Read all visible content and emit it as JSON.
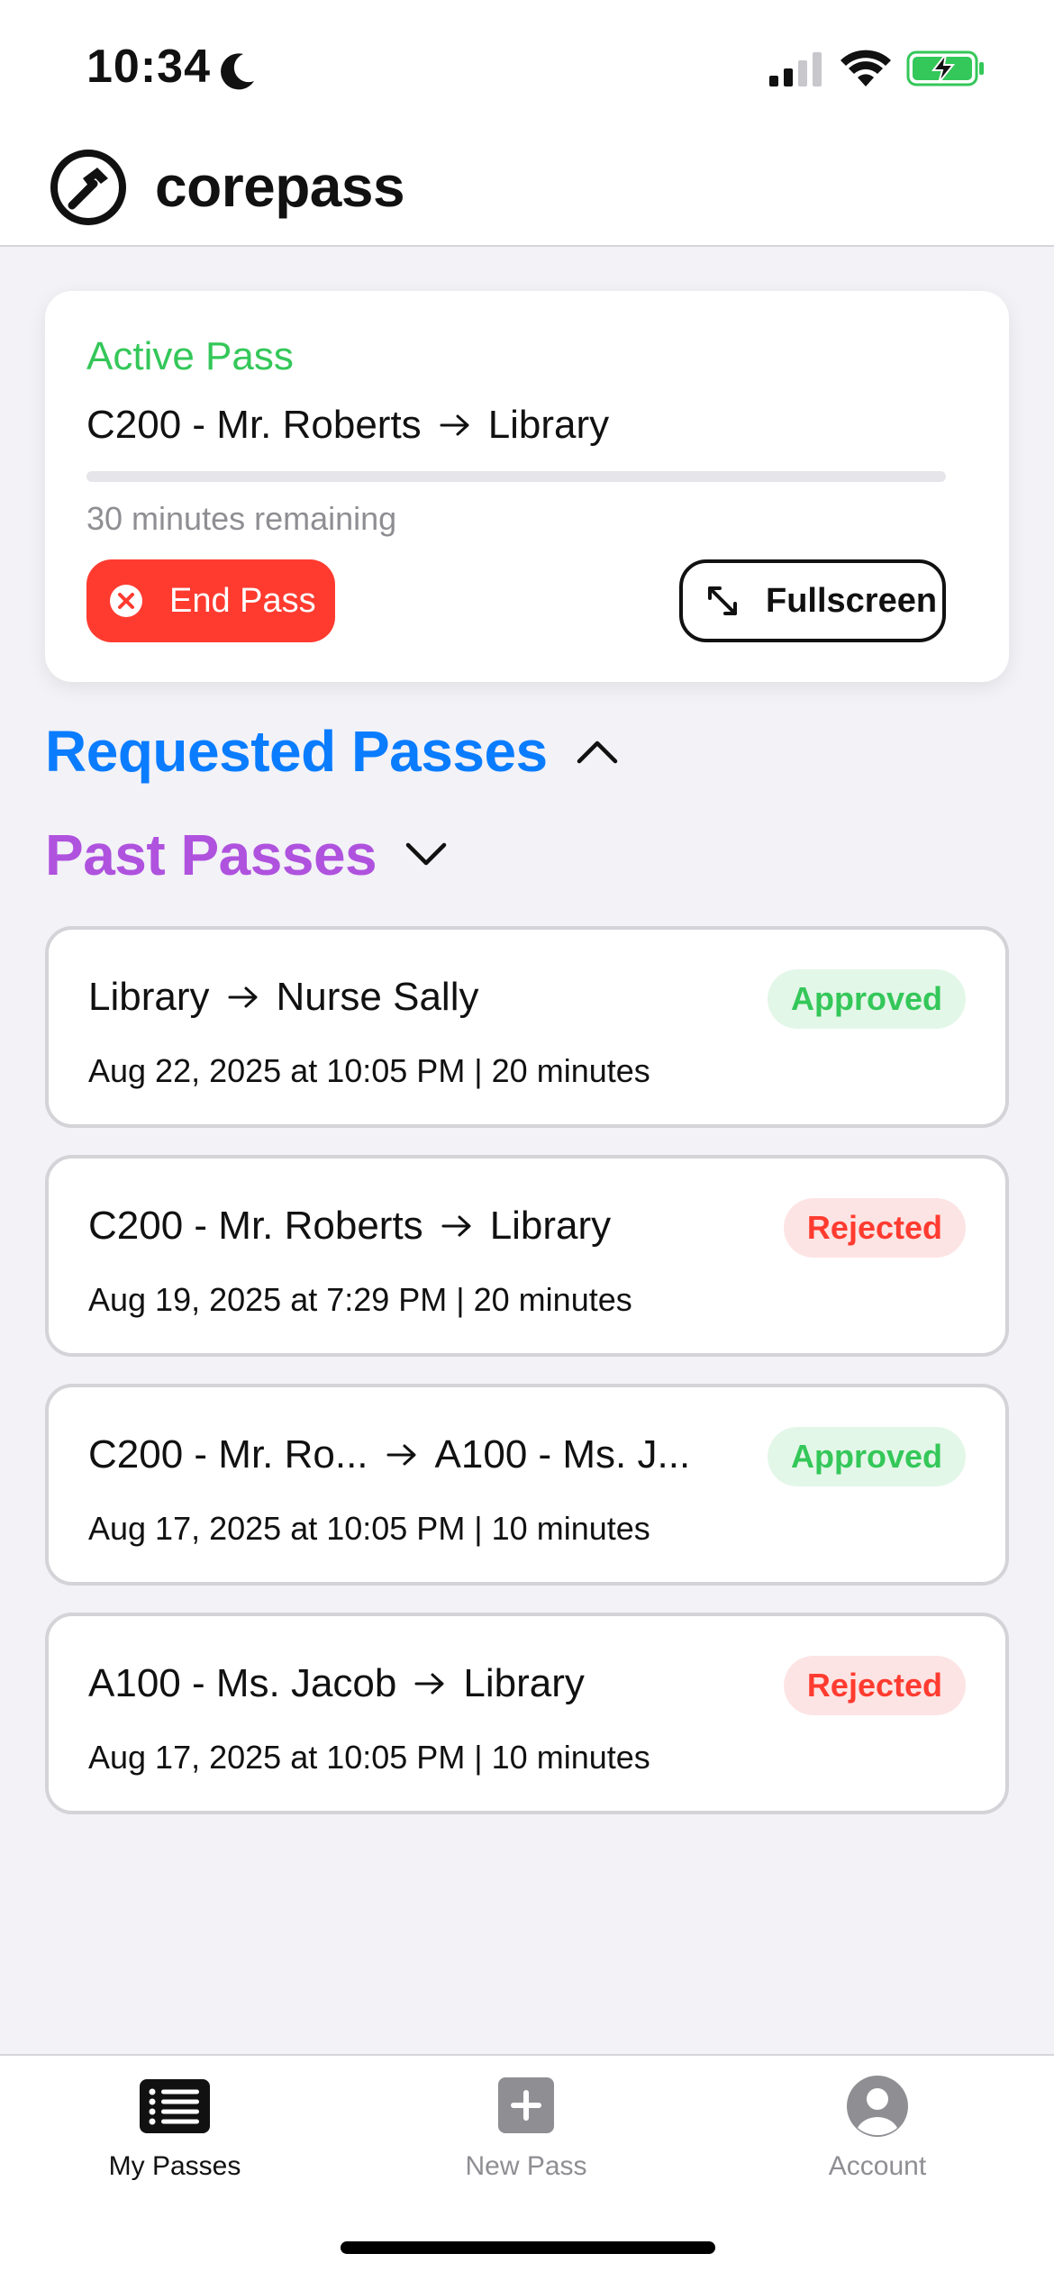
{
  "status_bar": {
    "time": "10:34",
    "icons": [
      "moon-icon",
      "signal-icon",
      "wifi-icon",
      "battery-charging-icon"
    ],
    "battery_color": "#34c759"
  },
  "header": {
    "title": "corepass",
    "logo_icon": "hammer-circle-icon"
  },
  "active_pass": {
    "label": "Active Pass",
    "from": "C200 - Mr. Roberts",
    "to": "Library",
    "remaining_text": "30 minutes remaining",
    "progress_fraction": 0.0,
    "end_button": "End Pass",
    "fullscreen_button": "Fullscreen"
  },
  "sections": {
    "requested": "Requested Passes",
    "past": "Past Passes"
  },
  "past_passes": [
    {
      "from": "Library",
      "to": "Nurse Sally",
      "meta": "Aug 22, 2025 at 10:05 PM | 20 minutes",
      "status": "Approved"
    },
    {
      "from": "C200 - Mr. Roberts",
      "to": "Library",
      "meta": "Aug 19, 2025 at 7:29 PM | 20 minutes",
      "status": "Rejected"
    },
    {
      "from": "C200 - Mr. Ro...",
      "to": "A100 - Ms. J...",
      "meta": "Aug 17, 2025 at 10:05 PM | 10 minutes",
      "status": "Approved"
    },
    {
      "from": "A100 - Ms. Jacob",
      "to": "Library",
      "meta": "Aug 17, 2025 at 10:05 PM | 10 minutes",
      "status": "Rejected"
    }
  ],
  "tab_bar": {
    "items": [
      {
        "label": "My Passes",
        "icon": "list-icon",
        "active": true
      },
      {
        "label": "New Pass",
        "icon": "plus-square-icon",
        "active": false
      },
      {
        "label": "Account",
        "icon": "person-circle-icon",
        "active": false
      }
    ]
  },
  "colors": {
    "accent_green": "#34c759",
    "danger_red": "#ff3b30",
    "requested_blue": "#0a7cff",
    "past_purple": "#af52de"
  }
}
